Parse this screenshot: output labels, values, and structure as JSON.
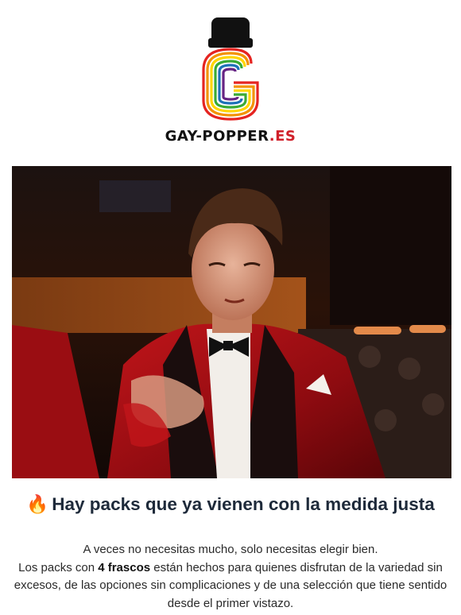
{
  "header": {
    "brand_main": "GAY-POPPER",
    "brand_tld": ".ES"
  },
  "colors": {
    "brand_red": "#d0202a",
    "headline": "#1e2a3a"
  },
  "icons": {
    "logo": "popper-bottle-rainbow-g-logo",
    "headline_icon": "fire-emoji"
  },
  "hero": {
    "alt": "hero-gif-man-in-red-velvet-tuxedo"
  },
  "headline": {
    "emoji": "🔥",
    "text": "Hay packs que ya vienen con la medida justa"
  },
  "body": {
    "line1": "A veces no necesitas mucho, solo necesitas elegir bien.",
    "line2_prefix": "Los packs con ",
    "line2_bold": "4 frascos",
    "line2_suffix": " están hechos para quienes disfrutan de la variedad sin excesos, de las opciones sin complicaciones y de una selección que tiene sentido desde el primer vistazo."
  }
}
